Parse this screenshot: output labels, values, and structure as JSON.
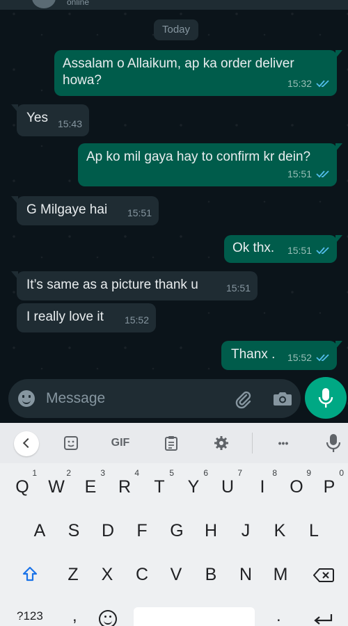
{
  "header": {
    "status": "online"
  },
  "date_divider": "Today",
  "messages": [
    {
      "dir": "out",
      "text": "Assalam o Allaikum, ap ka order deliver howa?",
      "time": "15:32",
      "read": true
    },
    {
      "dir": "in",
      "text": "Yes",
      "time": "15:43"
    },
    {
      "dir": "out",
      "text": "Ap ko mil gaya hay to confirm kr dein?",
      "time": "15:51",
      "read": true
    },
    {
      "dir": "in",
      "text": "G Milgaye hai",
      "time": "15:51"
    },
    {
      "dir": "out",
      "text": "Ok thx.",
      "time": "15:51",
      "read": true
    },
    {
      "dir": "in",
      "text": "It’s same as a picture thank u",
      "time": "15:51"
    },
    {
      "dir": "in",
      "text": "I really love it",
      "time": "15:52"
    },
    {
      "dir": "out",
      "text": "Thanx .",
      "time": "15:52",
      "read": true
    }
  ],
  "composer": {
    "placeholder": "Message",
    "icons": [
      "emoji-icon",
      "attach-icon",
      "camera-icon",
      "mic-icon"
    ]
  },
  "keyboard": {
    "toolbar": {
      "gif_label": "GIF",
      "more_label": "•••"
    },
    "row1": [
      {
        "k": "Q",
        "h": "1"
      },
      {
        "k": "W",
        "h": "2"
      },
      {
        "k": "E",
        "h": "3"
      },
      {
        "k": "R",
        "h": "4"
      },
      {
        "k": "T",
        "h": "5"
      },
      {
        "k": "Y",
        "h": "6"
      },
      {
        "k": "U",
        "h": "7"
      },
      {
        "k": "I",
        "h": "8"
      },
      {
        "k": "O",
        "h": "9"
      },
      {
        "k": "P",
        "h": "0"
      }
    ],
    "row2": [
      "A",
      "S",
      "D",
      "F",
      "G",
      "H",
      "J",
      "K",
      "L"
    ],
    "row3": [
      "Z",
      "X",
      "C",
      "V",
      "B",
      "N",
      "M"
    ],
    "bottom": {
      "symbols": "?123",
      "comma": ",",
      "period": "."
    }
  },
  "colors": {
    "outgoing": "#005c4b",
    "incoming": "#1f2c33",
    "read_ticks": "#53bdeb",
    "accent": "#00a884"
  }
}
